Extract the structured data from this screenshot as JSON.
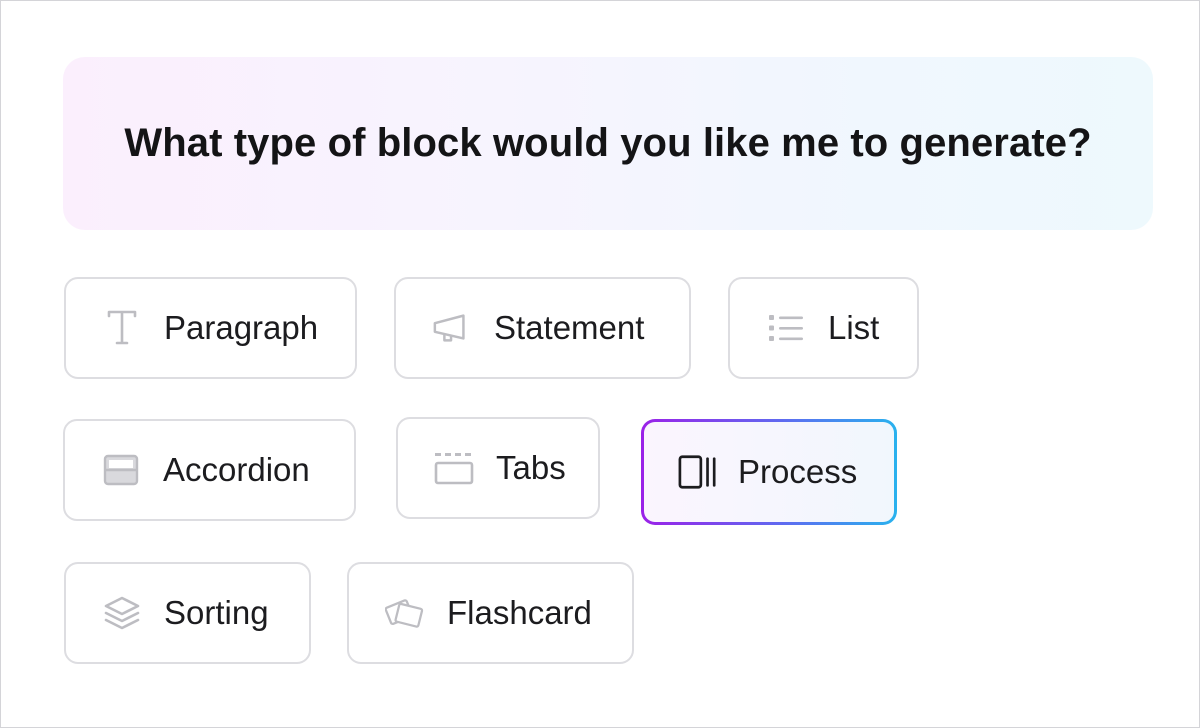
{
  "prompt": {
    "question": "What type of block would you like me to generate?"
  },
  "block_types": [
    {
      "label": "Paragraph",
      "icon": "text-t-icon",
      "selected": false
    },
    {
      "label": "Statement",
      "icon": "megaphone-icon",
      "selected": false
    },
    {
      "label": "List",
      "icon": "bulleted-list-icon",
      "selected": false
    },
    {
      "label": "Accordion",
      "icon": "accordion-icon",
      "selected": false
    },
    {
      "label": "Tabs",
      "icon": "tabs-icon",
      "selected": false
    },
    {
      "label": "Process",
      "icon": "process-icon",
      "selected": true
    },
    {
      "label": "Sorting",
      "icon": "layers-icon",
      "selected": false
    },
    {
      "label": "Flashcard",
      "icon": "flashcard-icon",
      "selected": false
    }
  ],
  "colors": {
    "icon_muted": "#bdbdc2",
    "icon_selected": "#1c1c1f",
    "selected_gradient_start": "#9b21e8",
    "selected_gradient_end": "#29b2ee"
  }
}
